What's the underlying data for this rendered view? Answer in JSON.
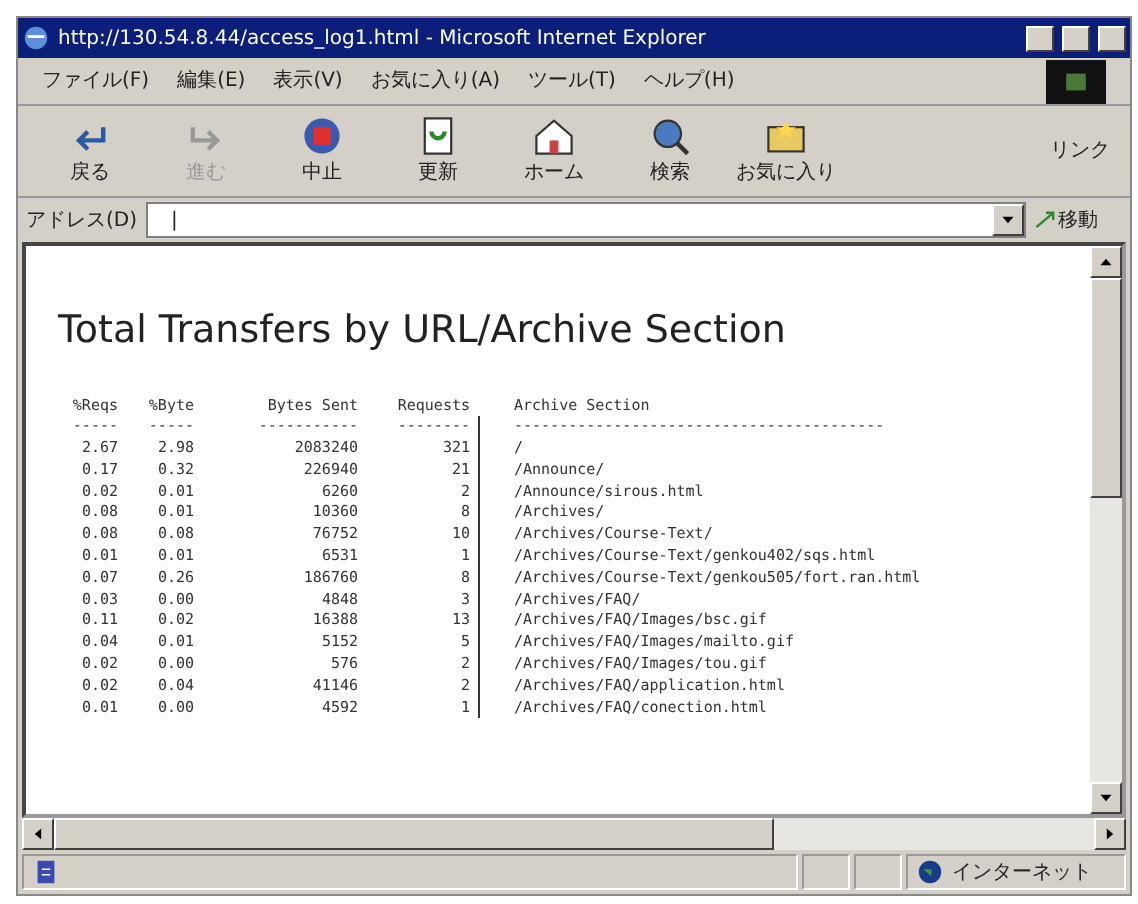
{
  "window": {
    "title": "http://130.54.8.44/access_log1.html - Microsoft Internet Explorer"
  },
  "menu": [
    "ファイル(F)",
    "編集(E)",
    "表示(V)",
    "お気に入り(A)",
    "ツール(T)",
    "ヘルプ(H)"
  ],
  "toolbar": [
    {
      "kind": "back",
      "label": "戻る",
      "disabled": false
    },
    {
      "kind": "forward",
      "label": "進む",
      "disabled": true
    },
    {
      "kind": "stop",
      "label": "中止",
      "disabled": false
    },
    {
      "kind": "refresh",
      "label": "更新",
      "disabled": false
    },
    {
      "kind": "home",
      "label": "ホーム",
      "disabled": false
    },
    {
      "kind": "search",
      "label": "検索",
      "disabled": false
    },
    {
      "kind": "favorites",
      "label": "お気に入り",
      "disabled": false
    }
  ],
  "links_label": "リンク",
  "address": {
    "label": "アドレス(D)",
    "value": "|",
    "go": "移動"
  },
  "page": {
    "heading": "Total Transfers by URL/Archive Section",
    "columns": [
      {
        "label": "%Reqs",
        "rule": "-----"
      },
      {
        "label": "%Byte",
        "rule": "-----"
      },
      {
        "label": "Bytes Sent",
        "rule": "-----------"
      },
      {
        "label": "Requests",
        "rule": "--------"
      },
      {
        "label": "Archive Section",
        "rule": "-----------------------------------------"
      }
    ],
    "rows": [
      [
        "2.67",
        "2.98",
        "2083240",
        "321",
        "/"
      ],
      [
        "0.17",
        "0.32",
        "226940",
        "21",
        "/Announce/"
      ],
      [
        "0.02",
        "0.01",
        "6260",
        "2",
        "/Announce/sirous.html"
      ],
      [
        "0.08",
        "0.01",
        "10360",
        "8",
        "/Archives/"
      ],
      [
        "0.08",
        "0.08",
        "76752",
        "10",
        "/Archives/Course-Text/"
      ],
      [
        "0.01",
        "0.01",
        "6531",
        "1",
        "/Archives/Course-Text/genkou402/sqs.html"
      ],
      [
        "0.07",
        "0.26",
        "186760",
        "8",
        "/Archives/Course-Text/genkou505/fort.ran.html"
      ],
      [
        "0.03",
        "0.00",
        "4848",
        "3",
        "/Archives/FAQ/"
      ],
      [
        "0.11",
        "0.02",
        "16388",
        "13",
        "/Archives/FAQ/Images/bsc.gif"
      ],
      [
        "0.04",
        "0.01",
        "5152",
        "5",
        "/Archives/FAQ/Images/mailto.gif"
      ],
      [
        "0.02",
        "0.00",
        "576",
        "2",
        "/Archives/FAQ/Images/tou.gif"
      ],
      [
        "0.02",
        "0.04",
        "41146",
        "2",
        "/Archives/FAQ/application.html"
      ],
      [
        "0.01",
        "0.00",
        "4592",
        "1",
        "/Archives/FAQ/conection.html"
      ]
    ]
  },
  "status_bar": {
    "zone": "インターネット"
  }
}
